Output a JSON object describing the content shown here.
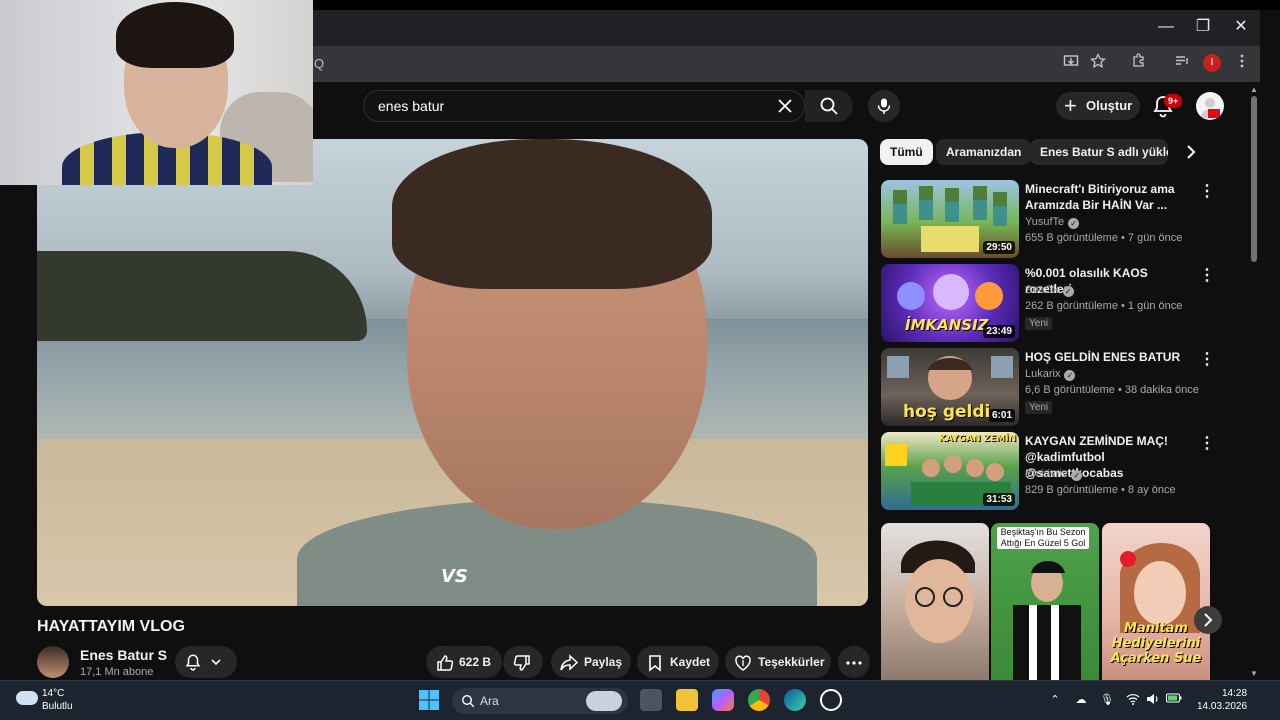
{
  "browser": {
    "url_fragment": "Q",
    "minimize": "—",
    "restore": "❐",
    "close": "✕",
    "profile_initial": "I"
  },
  "youtube": {
    "search": {
      "query": "enes batur"
    },
    "create_label": "Oluştur",
    "notification_badge": "9+"
  },
  "video": {
    "overlay_text": "VS",
    "title": "HAYATTAYIM VLOG",
    "channel": "Enes Batur S",
    "subscribers": "17,1 Mn abone",
    "likes": "622 B",
    "share_label": "Paylaş",
    "save_label": "Kaydet",
    "thanks_label": "Teşekkürler"
  },
  "chips": [
    {
      "label": "Tümü",
      "active": true
    },
    {
      "label": "Aramanızdan",
      "active": false
    },
    {
      "label": "Enes Batur S adlı yükleyici",
      "active": false
    }
  ],
  "recommendations": [
    {
      "title": "Minecraft'ı Bitiriyoruz ama Aramızda Bir HAİN Var ...",
      "channel": "YusufTe",
      "meta": "655 B görüntüleme • 7 gün önce",
      "duration": "29:50",
      "badge": ""
    },
    {
      "title": "%0.001 olasılık KAOS rozetleri",
      "channel": "SeeOk",
      "meta": "262 B görüntüleme • 1 gün önce",
      "duration": "23:49",
      "badge": "Yeni",
      "thumb_text": "İMKANSIZ"
    },
    {
      "title": "HOŞ GELDİN ENES BATUR",
      "channel": "Lukarix",
      "meta": "6,6 B görüntüleme • 38 dakika önce",
      "duration": "6:01",
      "badge": "Yeni",
      "thumb_text": "hoş geldi"
    },
    {
      "title": "KAYGAN ZEMİNDE MAÇ! @kadimfutbol @samettkocabas",
      "channel": "Emirivriv",
      "meta": "829 B görüntüleme • 8 ay önce",
      "duration": "31:53",
      "badge": "",
      "thumb_text": "KAYGAN ZEMİN"
    }
  ],
  "shorts": [
    {
      "caption": "",
      "overlay": ""
    },
    {
      "caption": "Beşiktaş'ın Bu Sezon Attığı En Güzel 5 Gol",
      "overlay": ""
    },
    {
      "caption": "",
      "overlay": "Manitam Hediyelerini Açarken Sue"
    }
  ],
  "taskbar": {
    "weather_temp": "14°C",
    "weather_desc": "Bulutlu",
    "search_label": "Ara",
    "time": "14:28",
    "date": "14.03.2026"
  },
  "colors": {
    "youtube_bg": "#0f0f0f",
    "chip_active": "#f1f1f1",
    "notification_red": "#cc0000",
    "taskbar_bg": "#1c2430"
  }
}
